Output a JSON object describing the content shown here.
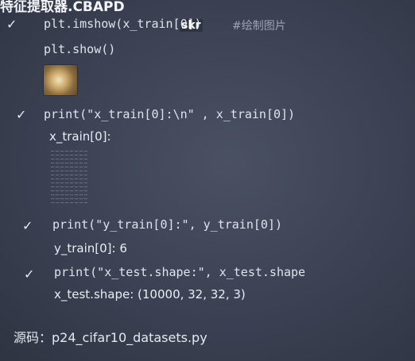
{
  "header": {
    "title": "特征提取器.CBAPD",
    "overlay": "skr"
  },
  "cells": [
    {
      "check": "✓",
      "code": "plt.imshow(x_train[0])",
      "comment": "#绘制图片"
    },
    {
      "code": "plt.show()"
    },
    {
      "check": "✓",
      "code": "print(\"x_train[0]:\\n\" , x_train[0])",
      "output": "x_train[0]:"
    },
    {
      "check": "✓",
      "code": "print(\"y_train[0]:\", y_train[0])",
      "output": "y_train[0]: 6"
    },
    {
      "check": "✓",
      "code": "print(\"x_test.shape:\", x_test.shape",
      "output": "x_test.shape:  (10000, 32, 32, 3)"
    }
  ],
  "footer": {
    "source": "源码：p24_cifar10_datasets.py"
  }
}
